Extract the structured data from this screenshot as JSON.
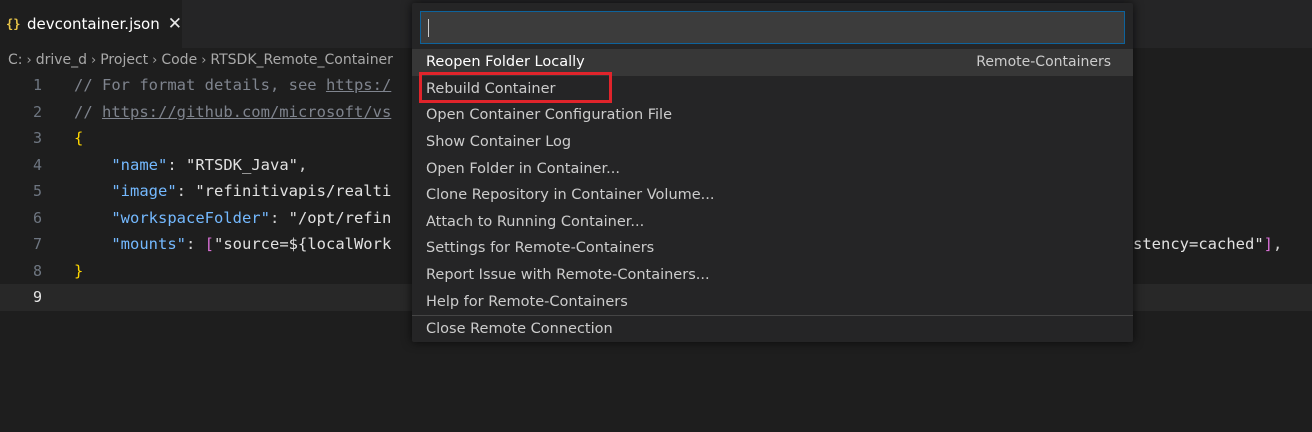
{
  "tab": {
    "icon": "{}",
    "title": "devcontainer.json",
    "close": "✕"
  },
  "breadcrumb": [
    "C:",
    "drive_d",
    "Project",
    "Code",
    "RTSDK_Remote_Container"
  ],
  "editor": {
    "line_numbers": [
      "1",
      "2",
      "3",
      "4",
      "5",
      "6",
      "7",
      "8",
      "9"
    ],
    "current_line": "9",
    "lines": {
      "l1_comment": "// For format details, see ",
      "l1_link": "https:/",
      "l2_comment": "// ",
      "l2_link": "https://github.com/microsoft/vs",
      "l3_brace": "{",
      "l4_key": "\"name\"",
      "l4_sep": ": ",
      "l4_val": "\"RTSDK_Java\"",
      "l4_end": ",",
      "l5_key": "\"image\"",
      "l5_sep": ": ",
      "l5_val": "\"refinitivapis/realti",
      "l6_key": "\"workspaceFolder\"",
      "l6_sep": ": ",
      "l6_val": "\"/opt/refin",
      "l7_key": "\"mounts\"",
      "l7_sep": ": ",
      "l7_bracket": "[",
      "l7_val": "\"source=${localWork",
      "l7_tail_val": "stency=cached\"",
      "l7_tail_bracket": "]",
      "l7_tail_end": ",",
      "l8_brace": "}"
    }
  },
  "quick_pick": {
    "input_value": "",
    "items": [
      {
        "label": "Reopen Folder Locally",
        "detail": "Remote-Containers"
      },
      {
        "label": "Rebuild Container"
      },
      {
        "label": "Open Container Configuration File"
      },
      {
        "label": "Show Container Log"
      },
      {
        "label": "Open Folder in Container..."
      },
      {
        "label": "Clone Repository in Container Volume..."
      },
      {
        "label": "Attach to Running Container..."
      },
      {
        "label": "Settings for Remote-Containers"
      },
      {
        "label": "Report Issue with Remote-Containers..."
      },
      {
        "label": "Help for Remote-Containers"
      },
      {
        "label": "Close Remote Connection"
      }
    ]
  },
  "colors": {
    "highlight_box": "#e0242b",
    "focus_border": "#0e639c",
    "json_icon": "#e8c548"
  }
}
